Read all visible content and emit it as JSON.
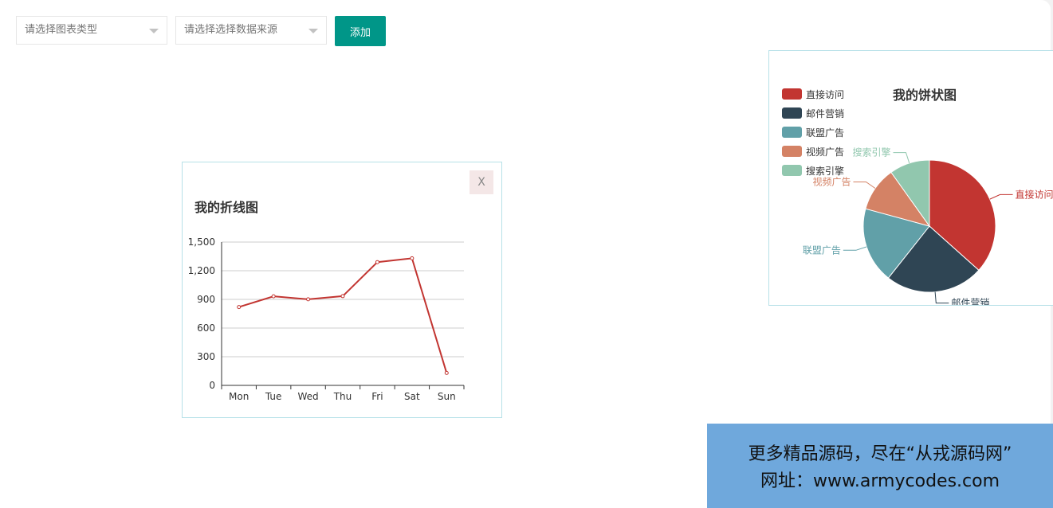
{
  "toolbar": {
    "chart_type_placeholder": "请选择图表类型",
    "data_source_placeholder": "请选择选择数据来源",
    "add_label": "添加"
  },
  "line_card": {
    "title": "我的折线图",
    "close_label": "X"
  },
  "pie_card": {
    "title": "我的饼状图"
  },
  "banner": {
    "line1": "更多精品源码，尽在“从戎源码网”",
    "line2": "网址：www.armycodes.com"
  },
  "colors": {
    "accent": "#009688",
    "line": "#c23531",
    "pie": [
      "#c23531",
      "#2f4554",
      "#61a0a8",
      "#d48265",
      "#91c7ae"
    ]
  },
  "chart_data": [
    {
      "type": "line",
      "title": "我的折线图",
      "categories": [
        "Mon",
        "Tue",
        "Wed",
        "Thu",
        "Fri",
        "Sat",
        "Sun"
      ],
      "values": [
        820,
        932,
        901,
        934,
        1290,
        1330,
        130
      ],
      "ylim": [
        0,
        1500
      ],
      "yticks": [
        0,
        300,
        600,
        900,
        1200,
        1500
      ],
      "yticklabels": [
        "0",
        "300",
        "600",
        "900",
        "1,200",
        "1,500"
      ],
      "grid": true
    },
    {
      "type": "pie",
      "title": "我的饼状图",
      "labels": [
        "直接访问",
        "邮件营销",
        "联盟广告",
        "视频广告",
        "搜索引擎"
      ],
      "values": [
        335,
        220,
        170,
        100,
        90
      ],
      "legend": "top-left"
    }
  ]
}
